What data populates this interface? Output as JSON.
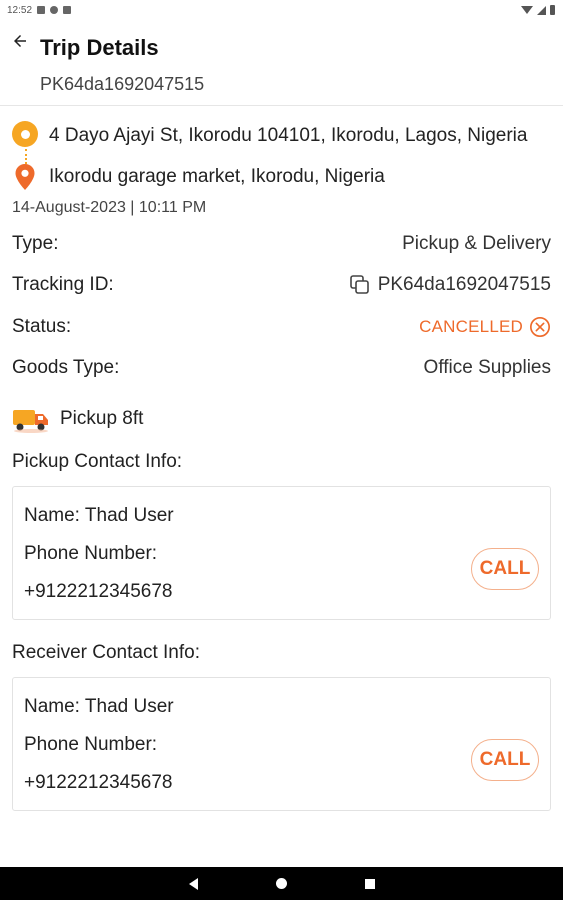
{
  "status_bar": {
    "time": "12:52"
  },
  "header": {
    "title": "Trip Details",
    "subtitle": "PK64da1692047515"
  },
  "route": {
    "pickup_address": "4 Dayo Ajayi St, Ikorodu 104101, Ikorodu, Lagos, Nigeria",
    "dropoff_address": "Ikorodu garage market, Ikorodu, Nigeria",
    "date": "14-August-2023 | 10:11 PM"
  },
  "details": {
    "type_label": "Type:",
    "type_value": "Pickup & Delivery",
    "tracking_label": "Tracking ID:",
    "tracking_value": "PK64da1692047515",
    "status_label": "Status:",
    "status_value": "CANCELLED",
    "goods_label": "Goods Type:",
    "goods_value": "Office Supplies"
  },
  "vehicle": {
    "label": "Pickup 8ft"
  },
  "pickup_contact": {
    "section_title": "Pickup Contact Info:",
    "name": "Name: Thad User",
    "phone_label": "Phone Number:",
    "phone_value": "+9122212345678",
    "call_label": "CALL"
  },
  "receiver_contact": {
    "section_title": "Receiver Contact Info:",
    "name": "Name: Thad User",
    "phone_label": "Phone Number:",
    "phone_value": "+9122212345678",
    "call_label": "CALL"
  },
  "colors": {
    "accent": "#ee6a2b",
    "pin": "#f6a623"
  },
  "icons": [
    "back-arrow-icon",
    "origin-pin-icon",
    "location-pin-icon",
    "copy-icon",
    "cancel-circle-icon",
    "truck-icon"
  ]
}
